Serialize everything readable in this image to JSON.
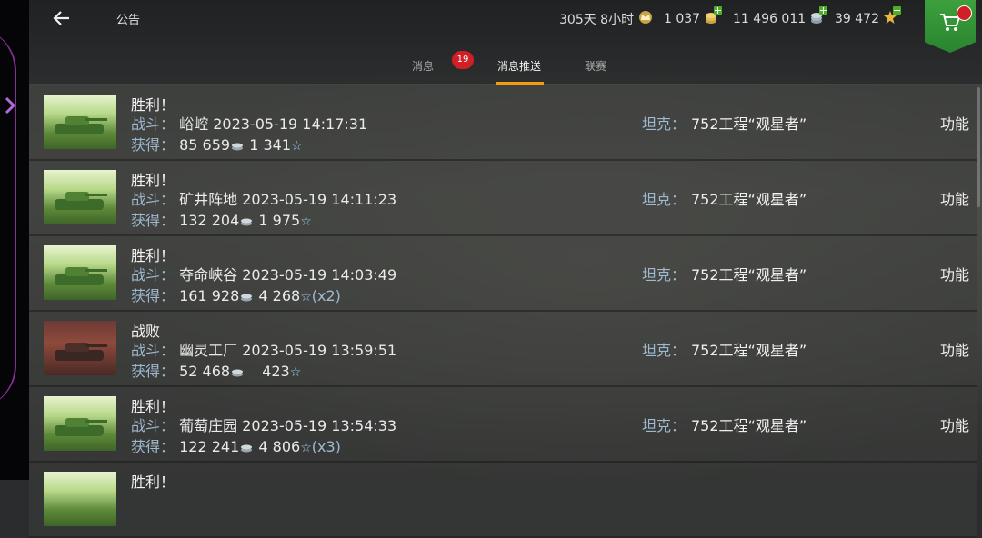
{
  "header": {
    "title": "公告",
    "premium_time": "305天 8小时",
    "gold": "1 037",
    "credits": "11 496 011",
    "free_xp": "39 472",
    "shop_badge_color": "#d01f25"
  },
  "tabs": [
    {
      "label": "消息",
      "active": false
    },
    {
      "label": "消息推送",
      "active": true
    },
    {
      "label": "联赛",
      "active": false
    }
  ],
  "tab_badge": "19",
  "labels": {
    "battle": "战斗：",
    "earned": "获得：",
    "tank": "坦克：",
    "function": "功能"
  },
  "rows": [
    {
      "result": "胜利！",
      "map": "峪崆",
      "datetime": "2023-05-19 14:17:31",
      "credits": "85 659",
      "xp": "1 341",
      "mult": "",
      "tank": "752工程“观星者”"
    },
    {
      "result": "胜利！",
      "map": "矿井阵地",
      "datetime": "2023-05-19 14:11:23",
      "credits": "132 204",
      "xp": "1 975",
      "mult": "",
      "tank": "752工程“观星者”"
    },
    {
      "result": "胜利！",
      "map": "夺命峡谷",
      "datetime": "2023-05-19 14:03:49",
      "credits": "161 928",
      "xp": "4 268",
      "mult": "(x2)",
      "tank": "752工程“观星者”"
    },
    {
      "result": "战败",
      "map": "幽灵工厂",
      "datetime": "2023-05-19 13:59:51",
      "credits": "52 468",
      "xp": "423",
      "mult": "",
      "tank": "752工程“观星者”"
    },
    {
      "result": "胜利！",
      "map": "葡萄庄园",
      "datetime": "2023-05-19 13:54:33",
      "credits": "122 241",
      "xp": "4 806",
      "mult": "(x3)",
      "tank": "752工程“观星者”"
    },
    {
      "result": "胜利！",
      "map": "",
      "datetime": "",
      "credits": "",
      "xp": "",
      "mult": "",
      "tank": ""
    }
  ]
}
